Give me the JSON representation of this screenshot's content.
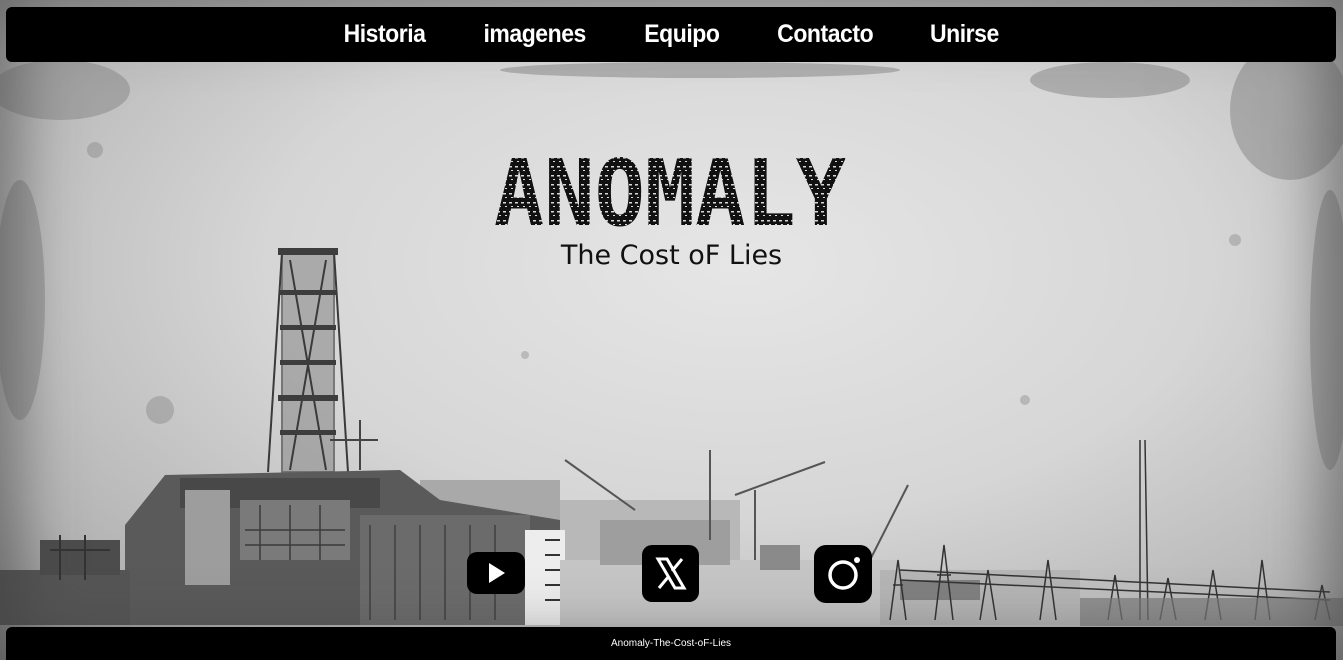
{
  "nav": {
    "items": [
      {
        "label": "Historia"
      },
      {
        "label": "imagenes"
      },
      {
        "label": "Equipo"
      },
      {
        "label": "Contacto"
      },
      {
        "label": "Unirse"
      }
    ]
  },
  "hero": {
    "logo_text": "ANOMALY",
    "tagline": "The Cost oF Lies"
  },
  "social": [
    {
      "icon": "youtube-icon"
    },
    {
      "icon": "x-twitter-icon"
    },
    {
      "icon": "instagram-icon"
    }
  ],
  "footer": {
    "text": "Anomaly-The-Cost-oF-Lies"
  }
}
